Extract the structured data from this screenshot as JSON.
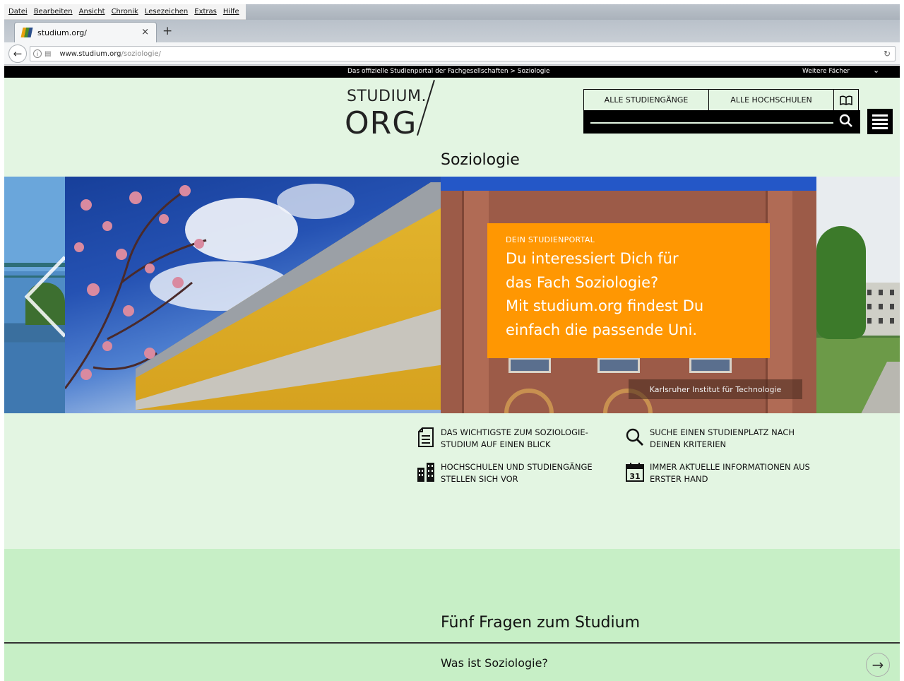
{
  "browser": {
    "menu": [
      "Datei",
      "Bearbeiten",
      "Ansicht",
      "Chronik",
      "Lesezeichen",
      "Extras",
      "Hilfe"
    ],
    "tab_title": "studium.org/",
    "tab_close": "×",
    "new_tab": "+",
    "url_host": "www.studium.org",
    "url_path": "/soziologie/"
  },
  "site": {
    "breadcrumb": "Das offizielle Studienportal der Fachgesellschaften  >  Soziologie",
    "more_subjects": "Weitere Fächer",
    "logo_top": "STUDIUM.",
    "logo_bottom": "ORG",
    "nav": [
      "ALLE STUDIENGÄNGE",
      "ALLE HOCHSCHULEN"
    ],
    "page_title": "Soziologie",
    "hero": {
      "kicker": "DEIN STUDIENPORTAL",
      "line1": "Du interessiert Dich für",
      "line2": "das Fach Soziologie?",
      "line3": "Mit studium.org findest Du",
      "line4": "einfach die passende Uni.",
      "caption": "Karlsruher Institut für Technologie"
    },
    "features": [
      {
        "icon": "document-icon",
        "text": "DAS WICHTIGSTE ZUM SOZIOLOGIE-STUDIUM AUF EINEN BLICK"
      },
      {
        "icon": "search-icon",
        "text": "SUCHE EINEN STUDIENPLATZ NACH DEINEN KRITERIEN"
      },
      {
        "icon": "buildings-icon",
        "text": "HOCHSCHULEN UND STUDIENGÄNGE STELLEN SICH VOR"
      },
      {
        "icon": "calendar-icon",
        "text": "IMMER AKTUELLE INFORMATIONEN AUS ERSTER HAND",
        "calendar_day": "31"
      }
    ],
    "faq_heading": "Fünf Fragen zum Studium",
    "faq_first": "Was ist Soziologie?"
  },
  "colors": {
    "page_bg": "#e3f5e2",
    "band_bg": "#c7efc6",
    "accent_orange": "#ff9702",
    "black": "#000000"
  }
}
